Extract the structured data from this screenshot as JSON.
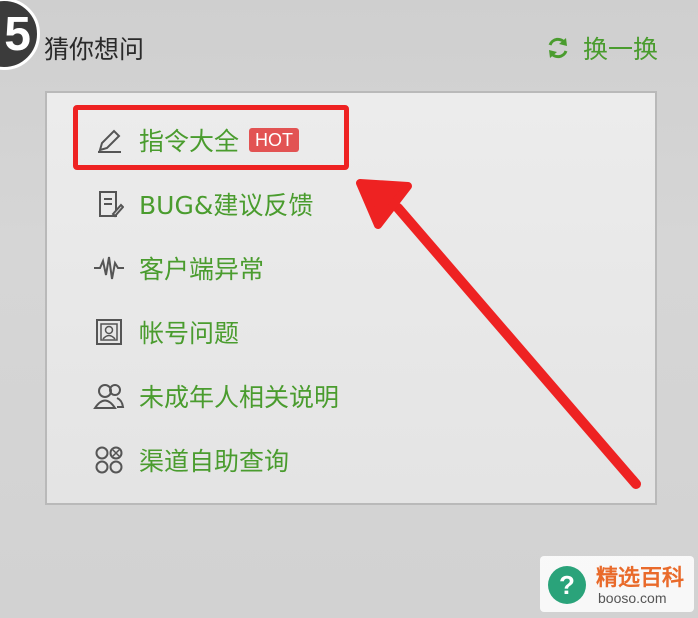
{
  "header": {
    "step_number": "5",
    "title": "猜你想问",
    "refresh_label": "换一换"
  },
  "menu": {
    "items": [
      {
        "label": "指令大全",
        "badge": "HOT",
        "icon": "pencil-icon"
      },
      {
        "label": "BUG&建议反馈",
        "icon": "feedback-note-icon"
      },
      {
        "label": "客户端异常",
        "icon": "waveform-icon"
      },
      {
        "label": "帐号问题",
        "icon": "id-card-icon"
      },
      {
        "label": "未成年人相关说明",
        "icon": "users-icon"
      },
      {
        "label": "渠道自助查询",
        "icon": "apps-grid-icon"
      }
    ]
  },
  "watermark": {
    "site_name": "精选百科",
    "url": "booso.com",
    "logo_symbol": "?"
  },
  "colors": {
    "accent_green": "#4a9c2e",
    "highlight_red": "#ee2222",
    "hot_badge": "#e25353"
  }
}
